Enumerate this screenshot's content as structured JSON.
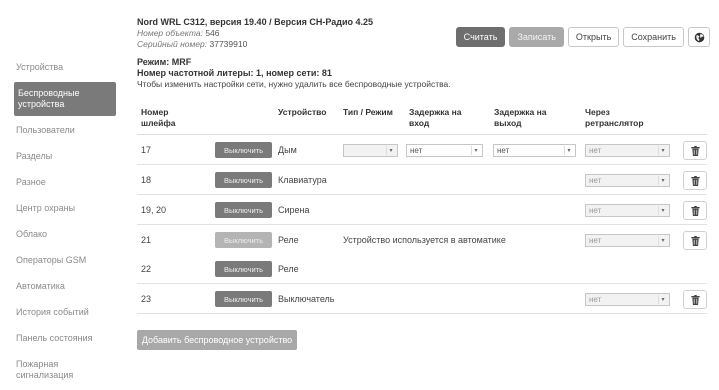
{
  "sidebar": {
    "items": [
      {
        "label": "Устройства"
      },
      {
        "label": "Беспроводные устройства",
        "active": true
      },
      {
        "label": "Пользователи"
      },
      {
        "label": "Разделы"
      },
      {
        "label": "Разное"
      },
      {
        "label": "Центр охраны"
      },
      {
        "label": "Облако"
      },
      {
        "label": "Операторы GSM"
      },
      {
        "label": "Автоматика"
      },
      {
        "label": "История событий"
      },
      {
        "label": "Панель состояния"
      },
      {
        "label": "Пожарная сигнализация"
      }
    ]
  },
  "header": {
    "title": "Nord WRL C312, версия 19.40 / Версия CH-Радио 4.25",
    "object_label": "Номер объекта:",
    "object_value": "546",
    "serial_label": "Серийный номер:",
    "serial_value": "37739910"
  },
  "toolbar": {
    "read_label": "Считать",
    "write_label": "Записать",
    "open_label": "Открыть",
    "save_label": "Сохранить",
    "globe_icon": "globe-icon"
  },
  "mode": {
    "line1": "Режим: MRF",
    "line2": "Номер частотной литеры: 1, номер сети: 81",
    "line3": "Чтобы изменить настройки сети, нужно удалить все беспроводные устройства."
  },
  "table": {
    "headers": {
      "loop": "Номер шлейфа",
      "device": "Устройство",
      "type": "Тип / Режим",
      "delay_in": "Задержка на вход",
      "delay_out": "Задержка на выход",
      "relay": "Через ретранслятор"
    },
    "off_label": "Выключить",
    "rows": [
      {
        "loop": "17",
        "device": "Дым",
        "type": "",
        "delay_in": "нет",
        "delay_out": "нет",
        "relay": "нет",
        "off_disabled": false,
        "has_type": true,
        "has_delays": true,
        "has_relay": true,
        "has_delete": true,
        "note": ""
      },
      {
        "loop": "18",
        "device": "Клавиатура",
        "relay": "нет",
        "off_disabled": false,
        "has_relay": true,
        "has_delete": true,
        "note": ""
      },
      {
        "loop": "19, 20",
        "device": "Сирена",
        "relay": "нет",
        "off_disabled": false,
        "has_relay": true,
        "has_delete": true,
        "note": ""
      },
      {
        "loop": "21",
        "device": "Реле",
        "relay": "нет",
        "off_disabled": true,
        "has_relay": true,
        "has_delete": true,
        "note": "Устройство используется в автоматике"
      },
      {
        "loop": "22",
        "device": "Реле",
        "off_disabled": false,
        "has_relay": false,
        "has_delete": false,
        "note": ""
      },
      {
        "loop": "23",
        "device": "Выключатель",
        "relay": "нет",
        "off_disabled": false,
        "has_relay": true,
        "has_delete": true,
        "note": ""
      }
    ]
  },
  "add_button_label": "Добавить беспроводное устройство"
}
